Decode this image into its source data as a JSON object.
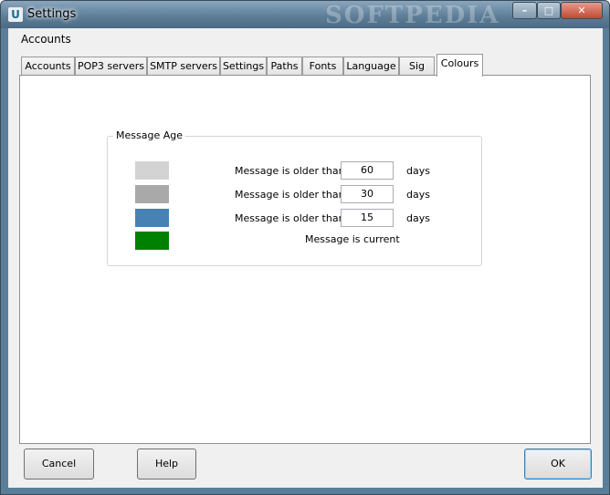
{
  "window": {
    "title": "Settings",
    "watermark": "SOFTPEDIA",
    "app_icon_glyph": "U",
    "minimize_glyph": "–",
    "maximize_glyph": "□",
    "close_glyph": "✕"
  },
  "header": {
    "section_title": "Accounts"
  },
  "tabs": [
    {
      "label": "Accounts"
    },
    {
      "label": "POP3 servers"
    },
    {
      "label": "SMTP servers"
    },
    {
      "label": "Settings"
    },
    {
      "label": "Paths"
    },
    {
      "label": "Fonts"
    },
    {
      "label": "Language"
    },
    {
      "label": "Sig"
    },
    {
      "label": "Colours",
      "active": true
    }
  ],
  "message_age": {
    "group_label": "Message Age",
    "rows": [
      {
        "color": "#d3d3d3",
        "label": "Message is older than",
        "value": "60",
        "unit": "days"
      },
      {
        "color": "#a9a9a9",
        "label": "Message is older than",
        "value": "30",
        "unit": "days"
      },
      {
        "color": "#4682b4",
        "label": "Message is older than",
        "value": "15",
        "unit": "days"
      },
      {
        "color": "#008000",
        "label": "Message is current"
      }
    ]
  },
  "buttons": {
    "cancel": "Cancel",
    "help": "Help",
    "ok": "OK"
  }
}
